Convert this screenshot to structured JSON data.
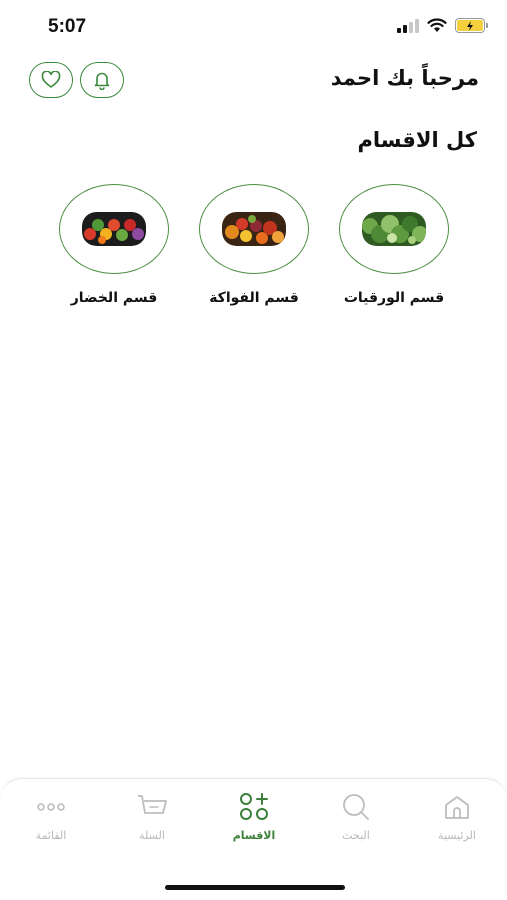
{
  "status_bar": {
    "time": "5:07"
  },
  "header": {
    "greeting": "مرحباً بك احمد"
  },
  "section": {
    "title": "كل الاقسام"
  },
  "categories": [
    {
      "label": "قسم الورقيات"
    },
    {
      "label": "قسم الفواكة"
    },
    {
      "label": "قسم الخضار"
    }
  ],
  "tabbar": {
    "items": [
      {
        "label": "الرئيسية",
        "icon": "home-icon"
      },
      {
        "label": "البحث",
        "icon": "search-icon"
      },
      {
        "label": "الاقسام",
        "icon": "grid-plus-icon",
        "active": true
      },
      {
        "label": "السلة",
        "icon": "cart-icon"
      },
      {
        "label": "القائمة",
        "icon": "more-icon"
      }
    ]
  },
  "colors": {
    "accent": "#3b7f3a",
    "inactive": "#b8b8b8"
  }
}
